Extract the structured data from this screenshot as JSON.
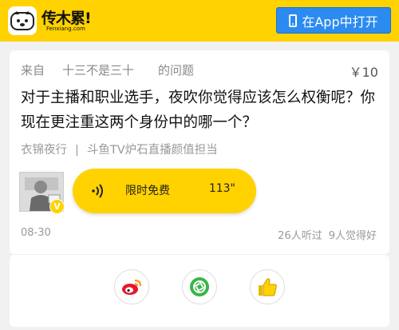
{
  "header": {
    "logo_text": "传木累!",
    "logo_sub": "Fenxiang.com",
    "open_app_label": "在App中打开"
  },
  "question_card": {
    "from_label": "来自",
    "asker": "十三不是三十",
    "question_suffix": "的问题",
    "price": "￥10",
    "question_text": "对于主播和职业选手，夜吹你觉得应该怎么权衡呢？你现在更注重这两个身份中的哪一个？",
    "answerer_name": "衣锦夜行",
    "separator": "|",
    "answerer_title": "斗鱼TV炉石直播颜值担当",
    "verified_badge": "V",
    "voice": {
      "label": "限时免费",
      "duration": "113\""
    },
    "date": "08-30",
    "listened": "26人听过",
    "liked": "9人觉得好"
  },
  "share": {
    "items": [
      "weibo-icon",
      "moments-icon",
      "thumbs-up-icon"
    ]
  },
  "colors": {
    "brand_yellow": "#ffd200",
    "app_button_blue": "#2b8bf0",
    "weibo_red": "#e6162d",
    "moments_green": "#39b54a"
  }
}
